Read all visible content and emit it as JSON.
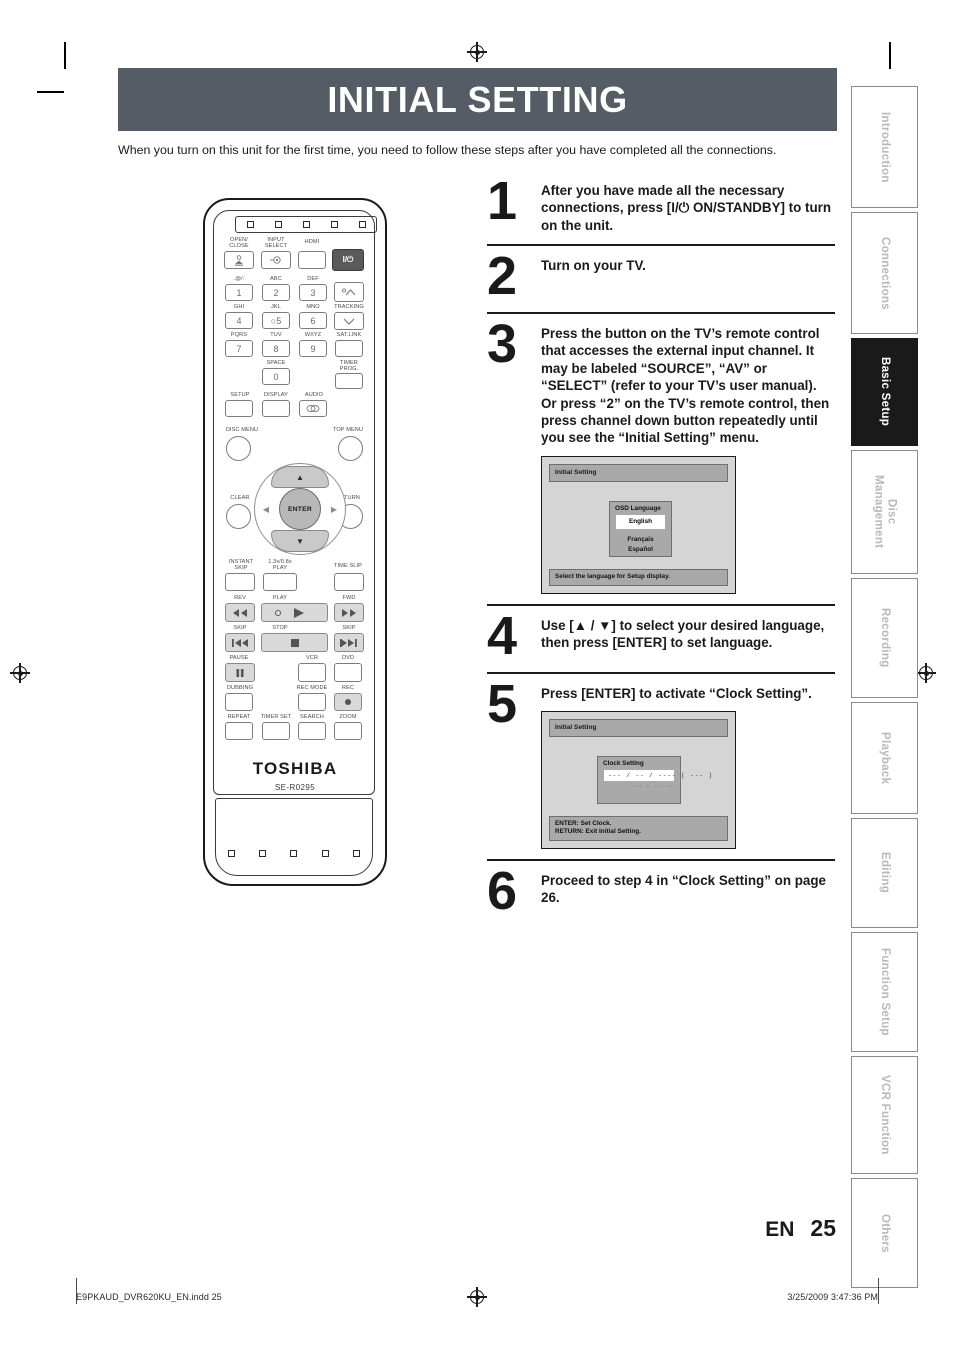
{
  "header": {
    "title": "INITIAL SETTING",
    "band_color": "#565c66",
    "intro": "When you turn on this unit for the first time, you need to follow these steps after you have completed all the connections."
  },
  "side_tabs": [
    {
      "label": "Introduction",
      "active": false
    },
    {
      "label": "Connections",
      "active": false
    },
    {
      "label": "Basic Setup",
      "active": true
    },
    {
      "label": "Disc\nManagement",
      "active": false
    },
    {
      "label": "Recording",
      "active": false
    },
    {
      "label": "Playback",
      "active": false
    },
    {
      "label": "Editing",
      "active": false
    },
    {
      "label": "Function Setup",
      "active": false
    },
    {
      "label": "VCR Function",
      "active": false
    },
    {
      "label": "Others",
      "active": false
    }
  ],
  "remote": {
    "brand": "TOSHIBA",
    "model": "SE-R0295",
    "labels": {
      "open_close": "OPEN/\nCLOSE",
      "input_select": "INPUT\nSELECT",
      "hdmi": "HDMI",
      "key1_alpha": ".@/:",
      "key2_alpha": "ABC",
      "key3_alpha": "DEF",
      "key4_alpha": "GHI",
      "key5_alpha": "JKL",
      "key6_alpha": "MNO",
      "key7_alpha": "PQRS",
      "key8_alpha": "TUV",
      "key9_alpha": "WXYZ",
      "key0_alpha": "SPACE",
      "tracking": "TRACKING",
      "sat_link": "SAT.LINK",
      "timer_prog": "TIMER\nPROG.",
      "setup": "SETUP",
      "display": "DISPLAY",
      "audio": "AUDIO",
      "disc_menu": "DISC MENU",
      "top_menu": "TOP MENU",
      "clear": "CLEAR",
      "return": "RETURN",
      "instant_skip": "INSTANT\nSKIP",
      "play_speed": "1.3x/0.8x\nPLAY",
      "time_slip": "TIME SLIP",
      "rev": "REV",
      "play": "PLAY",
      "fwd": "FWD",
      "skip_back": "SKIP",
      "stop": "STOP",
      "skip_fwd": "SKIP",
      "pause": "PAUSE",
      "vcr": "VCR",
      "dvd": "DVD",
      "dubbing": "DUBBING",
      "rec_mode": "REC MODE",
      "rec": "REC",
      "repeat": "REPEAT",
      "timer_set": "TIMER SET",
      "search": "SEARCH",
      "zoom": "ZOOM",
      "enter": "ENTER",
      "power": "I/⏻"
    },
    "numbers": [
      "1",
      "2",
      "3",
      "4",
      "5",
      "6",
      "7",
      "8",
      "9",
      "0"
    ]
  },
  "steps": [
    {
      "number": "1",
      "text": "After you have made all the necessary connections, press [I/⏻ ON/STANDBY] to turn on the unit."
    },
    {
      "number": "2",
      "text": "Turn on your TV."
    },
    {
      "number": "3",
      "text": "Press the button on the TV’s remote control that accesses the external input channel. It may be labeled “SOURCE”, “AV” or “SELECT” (refer to your TV’s user manual). Or press “2” on the TV’s remote control, then press channel down button repeatedly until you see the “Initial Setting” menu."
    },
    {
      "number": "4",
      "text": "Use [▲ / ▼] to select your desired language, then press [ENTER] to set language."
    },
    {
      "number": "5",
      "text": "Press [ENTER] to activate “Clock Setting”."
    },
    {
      "number": "6",
      "text": "Proceed to step 4 in “Clock Setting” on page 26."
    }
  ],
  "osd_language": {
    "screen_title": "Initial Setting",
    "box_title": "OSD Language",
    "options": [
      "English",
      "Français",
      "Español"
    ],
    "selected": "English",
    "footer": "Select the language for Setup display."
  },
  "osd_clock": {
    "screen_title": "Initial Setting",
    "box_title": "Clock Setting",
    "field": "--- / -- / ---- ( --- )",
    "field_sub": "-- : -- --",
    "footer_line1": "ENTER:    Set Clock.",
    "footer_line2": "RETURN: Exit Initial Setting."
  },
  "footer": {
    "lang": "EN",
    "page": "25",
    "print_file": "E9PKAUD_DVR620KU_EN.indd   25",
    "print_time": "3/25/2009   3:47:36 PM"
  }
}
